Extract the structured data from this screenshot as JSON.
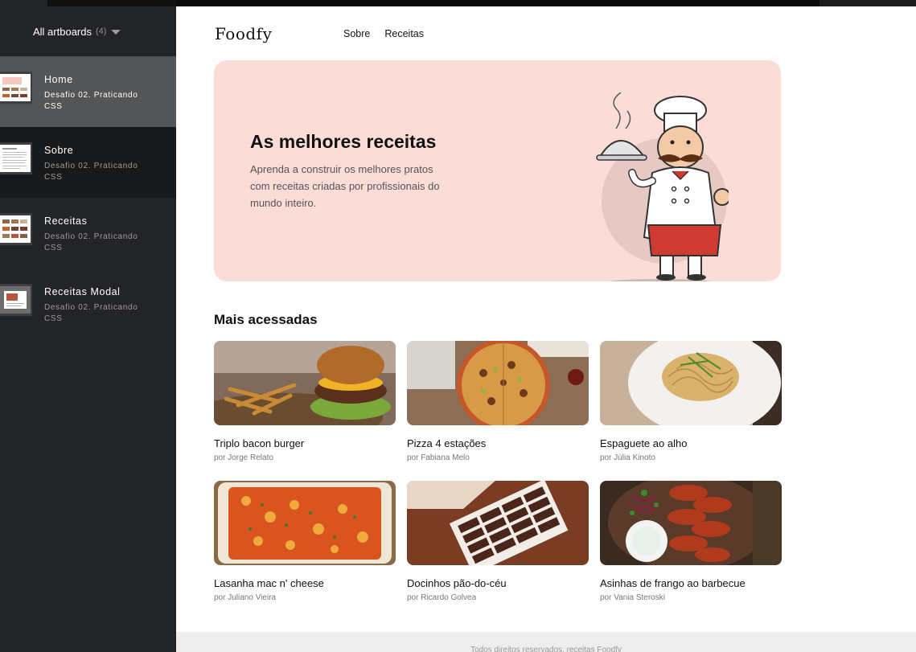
{
  "sidebar": {
    "header": {
      "label": "All artboards",
      "count": "(4)"
    },
    "artboards": [
      {
        "title": "Home",
        "subtitle": "Desafio 02. Praticando CSS"
      },
      {
        "title": "Sobre",
        "subtitle": "Desafio 02. Praticando CSS"
      },
      {
        "title": "Receitas",
        "subtitle": "Desafio 02. Praticando CSS"
      },
      {
        "title": "Receitas Modal",
        "subtitle": "Desafio 02. Praticando CSS"
      }
    ]
  },
  "site": {
    "logo": "Foodfy",
    "nav": [
      "Sobre",
      "Receitas"
    ],
    "hero": {
      "title": "As melhores receitas",
      "text": "Aprenda a construir os melhores pratos com receitas criadas por profissionais do mundo inteiro."
    },
    "section_title": "Mais acessadas",
    "recipes": [
      {
        "name": "Triplo bacon burger",
        "author": "por Jorge Relato",
        "image": "burger-photo"
      },
      {
        "name": "Pizza 4 estações",
        "author": "por Fabiana Melo",
        "image": "pizza-photo"
      },
      {
        "name": "Espaguete ao alho",
        "author": "por Júlia Kinoto",
        "image": "spaghetti-photo"
      },
      {
        "name": "Lasanha mac n' cheese",
        "author": "por Juliano Vieira",
        "image": "lasagna-photo"
      },
      {
        "name": "Docinhos pão-do-céu",
        "author": "por Ricardo Golvea",
        "image": "sweets-photo"
      },
      {
        "name": "Asinhas de frango ao barbecue",
        "author": "por Vania Steroski",
        "image": "chicken-wings-photo"
      }
    ],
    "footer": "Todos direitos reservados. receitas Foodfy"
  },
  "colors": {
    "hero_bg": "#fbdcd6",
    "sidebar_bg": "#232427",
    "sidebar_active": "#545557"
  }
}
